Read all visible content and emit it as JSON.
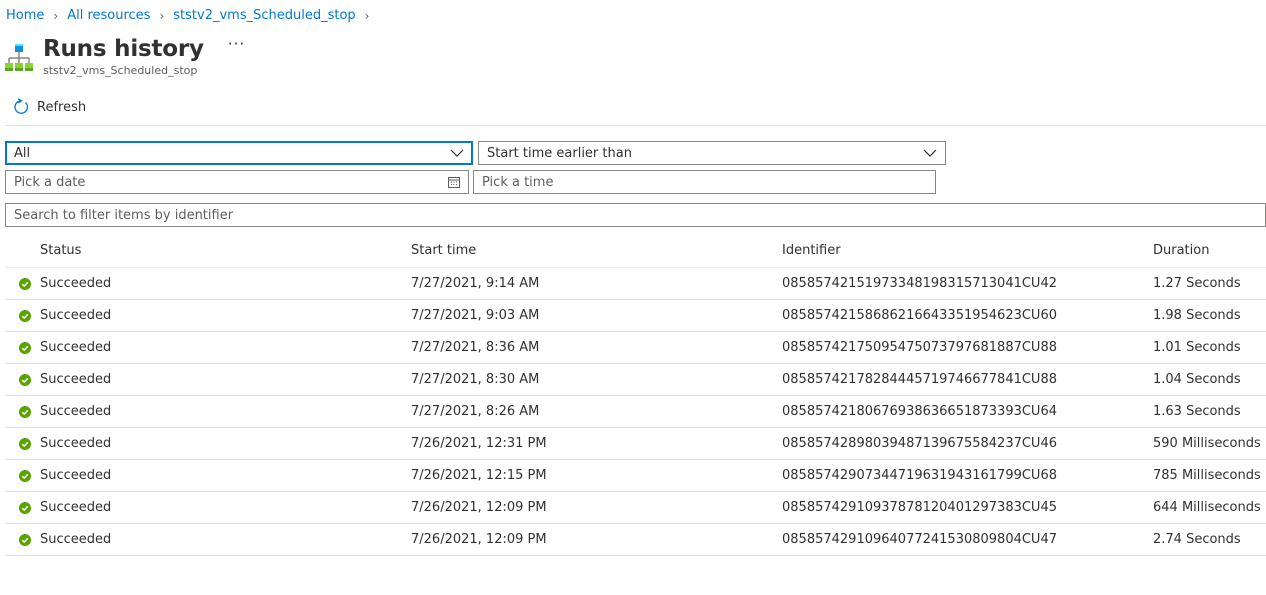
{
  "breadcrumb": [
    {
      "label": "Home"
    },
    {
      "label": "All resources"
    },
    {
      "label": "ststv2_vms_Scheduled_stop"
    }
  ],
  "header": {
    "title": "Runs history",
    "subtitle": "ststv2_vms_Scheduled_stop",
    "more_label": "···",
    "icon": "logic-app-icon"
  },
  "toolbar": {
    "refresh_label": "Refresh",
    "refresh_icon": "refresh-icon"
  },
  "filters": {
    "status_value": "All",
    "time_filter_value": "Start time earlier than",
    "date_placeholder": "Pick a date",
    "time_placeholder": "Pick a time",
    "search_placeholder": "Search to filter items by identifier"
  },
  "table": {
    "columns": {
      "status": "Status",
      "start_time": "Start time",
      "identifier": "Identifier",
      "duration": "Duration"
    },
    "rows": [
      {
        "status": "Succeeded",
        "start_time": "7/27/2021, 9:14 AM",
        "identifier": "08585742151973348198315713041CU42",
        "duration": "1.27 Seconds"
      },
      {
        "status": "Succeeded",
        "start_time": "7/27/2021, 9:03 AM",
        "identifier": "08585742158686216643351954623CU60",
        "duration": "1.98 Seconds"
      },
      {
        "status": "Succeeded",
        "start_time": "7/27/2021, 8:36 AM",
        "identifier": "08585742175095475073797681887CU88",
        "duration": "1.01 Seconds"
      },
      {
        "status": "Succeeded",
        "start_time": "7/27/2021, 8:30 AM",
        "identifier": "08585742178284445719746677841CU88",
        "duration": "1.04 Seconds"
      },
      {
        "status": "Succeeded",
        "start_time": "7/27/2021, 8:26 AM",
        "identifier": "08585742180676938636651873393CU64",
        "duration": "1.63 Seconds"
      },
      {
        "status": "Succeeded",
        "start_time": "7/26/2021, 12:31 PM",
        "identifier": "08585742898039487139675584237CU46",
        "duration": "590 Milliseconds"
      },
      {
        "status": "Succeeded",
        "start_time": "7/26/2021, 12:15 PM",
        "identifier": "08585742907344719631943161799CU68",
        "duration": "785 Milliseconds"
      },
      {
        "status": "Succeeded",
        "start_time": "7/26/2021, 12:09 PM",
        "identifier": "08585742910937878120401297383CU45",
        "duration": "644 Milliseconds"
      },
      {
        "status": "Succeeded",
        "start_time": "7/26/2021, 12:09 PM",
        "identifier": "08585742910964077241530809804CU47",
        "duration": "2.74 Seconds"
      }
    ]
  },
  "colors": {
    "accent": "#0078d4",
    "success": "#57a300",
    "text": "#323130"
  }
}
